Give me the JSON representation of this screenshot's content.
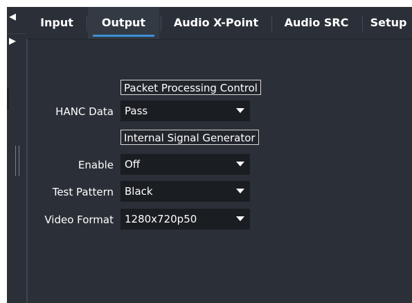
{
  "nav": {
    "left_arrow": "◀",
    "right_arrow": "▶"
  },
  "tabs": [
    {
      "label": "Input",
      "active": false
    },
    {
      "label": "Output",
      "active": true
    },
    {
      "label": "Audio X-Point",
      "active": false
    },
    {
      "label": "Audio SRC",
      "active": false
    },
    {
      "label": "Setup",
      "active": false
    }
  ],
  "sections": {
    "packet_processing": {
      "title": "Packet Processing Control",
      "hanc_data": {
        "label": "HANC Data",
        "value": "Pass"
      }
    },
    "signal_generator": {
      "title": "Internal Signal Generator",
      "enable": {
        "label": "Enable",
        "value": "Off"
      },
      "test_pattern": {
        "label": "Test Pattern",
        "value": "Black"
      },
      "video_format": {
        "label": "Video Format",
        "value": "1280x720p50"
      }
    }
  },
  "colors": {
    "background": "#2b3038",
    "dropdown": "#1a1d21",
    "accent": "#3b8fd6",
    "text": "#ffffff"
  }
}
